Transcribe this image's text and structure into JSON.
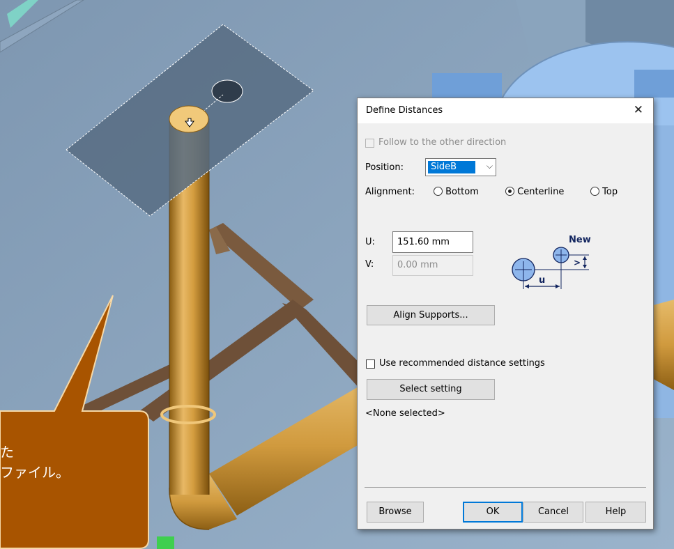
{
  "dialog": {
    "title": "Define Distances",
    "follow_label": "Follow to the other direction",
    "position_label": "Position:",
    "position_value": "SideB",
    "alignment_label": "Alignment:",
    "alignment_options": [
      "Bottom",
      "Centerline",
      "Top"
    ],
    "alignment_selected": "Centerline",
    "u_label": "U:",
    "u_value": "151.60 mm",
    "v_label": "V:",
    "v_value": "0.00 mm",
    "diagram_new": "New",
    "diagram_u": "u",
    "align_supports_label": "Align Supports...",
    "use_recommended_label": "Use recommended distance settings",
    "select_setting_label": "Select setting",
    "none_selected": "<None selected>",
    "buttons": {
      "browse": "Browse",
      "ok": "OK",
      "cancel": "Cancel",
      "help": "Help"
    }
  },
  "callout": {
    "line1": "た",
    "line2": "ファイル。"
  },
  "colors": {
    "pipe": "#d4a350",
    "floor": "#8fa9c3",
    "callout_fill": "#a85400",
    "accent": "#0078d7"
  }
}
